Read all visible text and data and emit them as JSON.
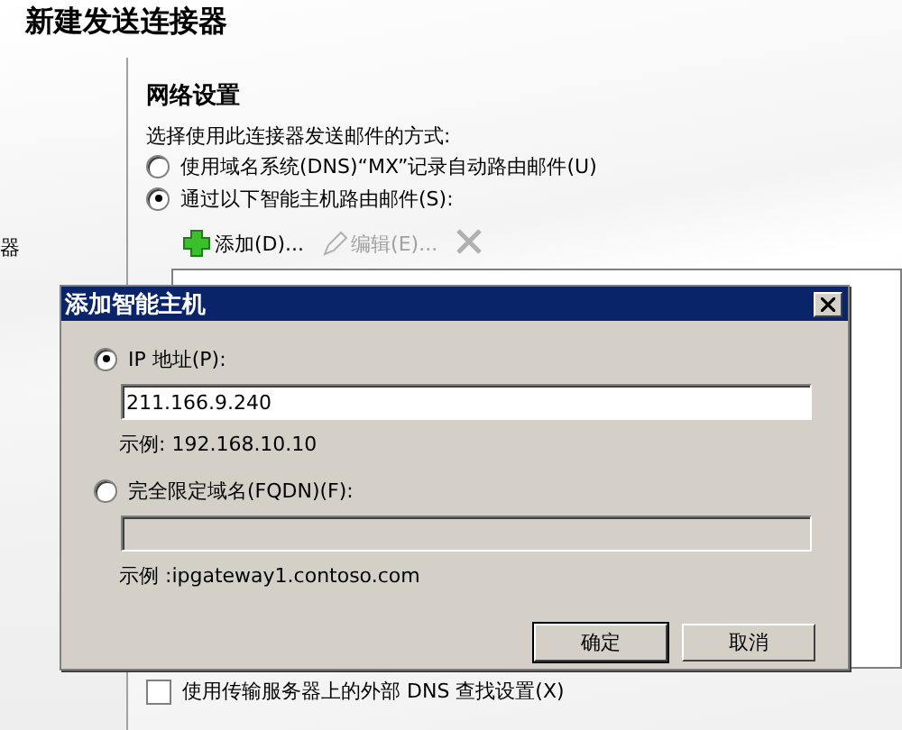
{
  "wizard": {
    "title": "新建发送连接器",
    "sidebar_item": "器",
    "section_title": "网络设置",
    "prompt": "选择使用此连接器发送邮件的方式:",
    "routing_options": [
      {
        "label": "使用域名系统(DNS)“MX”记录自动路由邮件(U)",
        "selected": false
      },
      {
        "label": "通过以下智能主机路由邮件(S):",
        "selected": true
      }
    ],
    "toolbar": [
      {
        "kind": "add",
        "label": "添加(D)...",
        "disabled": false
      },
      {
        "kind": "edit",
        "label": "编辑(E)...",
        "disabled": true
      },
      {
        "kind": "remove",
        "disabled": true
      }
    ],
    "external_dns": {
      "label": "使用传输服务器上的外部 DNS 查找设置(X)",
      "checked": false
    }
  },
  "dialog": {
    "title": "添加智能主机",
    "options": [
      {
        "label": "IP 地址(P):",
        "selected": true,
        "value": "211.166.9.240",
        "example": "示例: 192.168.10.10"
      },
      {
        "label": "完全限定域名(FQDN)(F):",
        "selected": false,
        "example": "示例 :ipgateway1.contoso.com"
      }
    ],
    "buttons": [
      {
        "label": "确定",
        "default": true
      },
      {
        "label": "取消",
        "default": false
      }
    ]
  }
}
